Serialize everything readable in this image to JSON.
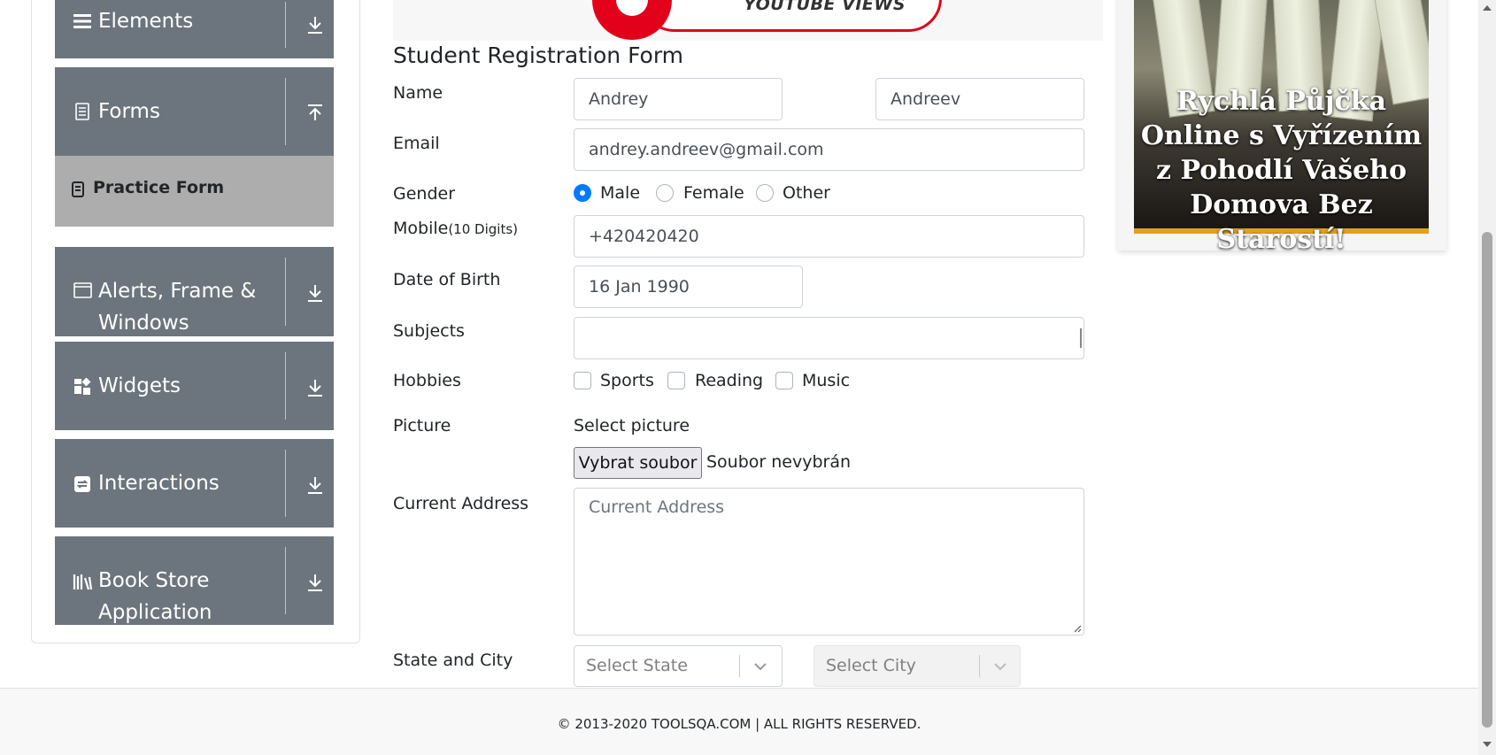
{
  "sidebar": {
    "groups": [
      {
        "label": "Elements",
        "icon": "list-icon",
        "toggle": "expand"
      },
      {
        "label": "Forms",
        "icon": "document-icon",
        "toggle": "collapse"
      },
      {
        "label": "Alerts, Frame &",
        "label2": "Windows",
        "icon": "window-icon",
        "toggle": "expand"
      },
      {
        "label": "Widgets",
        "icon": "widgets-icon",
        "toggle": "expand"
      },
      {
        "label": "Interactions",
        "icon": "interactions-icon",
        "toggle": "expand"
      },
      {
        "label": "Book Store",
        "label2": "Application",
        "icon": "bookshelf-icon",
        "toggle": "expand"
      }
    ],
    "active_item": "Practice Form"
  },
  "banner": {
    "text": "YOUTUBE VIEWS"
  },
  "form": {
    "title": "Student Registration Form",
    "name_label": "Name",
    "first_name": "Andrey",
    "last_name": "Andreev",
    "email_label": "Email",
    "email": "andrey.andreev@gmail.com",
    "gender_label": "Gender",
    "gender_options": [
      "Male",
      "Female",
      "Other"
    ],
    "gender_selected": "Male",
    "mobile_label": "Mobile",
    "mobile_hint": "(10 Digits)",
    "mobile": "+420420420",
    "dob_label": "Date of Birth",
    "dob": "16 Jan 1990",
    "subjects_label": "Subjects",
    "hobbies_label": "Hobbies",
    "hobbies": [
      "Sports",
      "Reading",
      "Music"
    ],
    "picture_label": "Picture",
    "picture_hint": "Select picture",
    "file_button": "Vybrat soubor",
    "file_status": "Soubor nevybrán",
    "address_label": "Current Address",
    "address_placeholder": "Current Address",
    "state_city_label": "State and City",
    "state_placeholder": "Select State",
    "city_placeholder": "Select City"
  },
  "ad": {
    "text": "Rychlá Půjčka Online s Vyřízením z Pohodlí Vašeho Domova Bez Starostí!"
  },
  "footer": {
    "text": "© 2013-2020 TOOLSQA.COM | ALL RIGHTS RESERVED."
  },
  "colors": {
    "menu_bg": "#6c757d",
    "active_bg": "#adadad",
    "primary": "#007bff",
    "ad_stripe": "#e0a020"
  }
}
